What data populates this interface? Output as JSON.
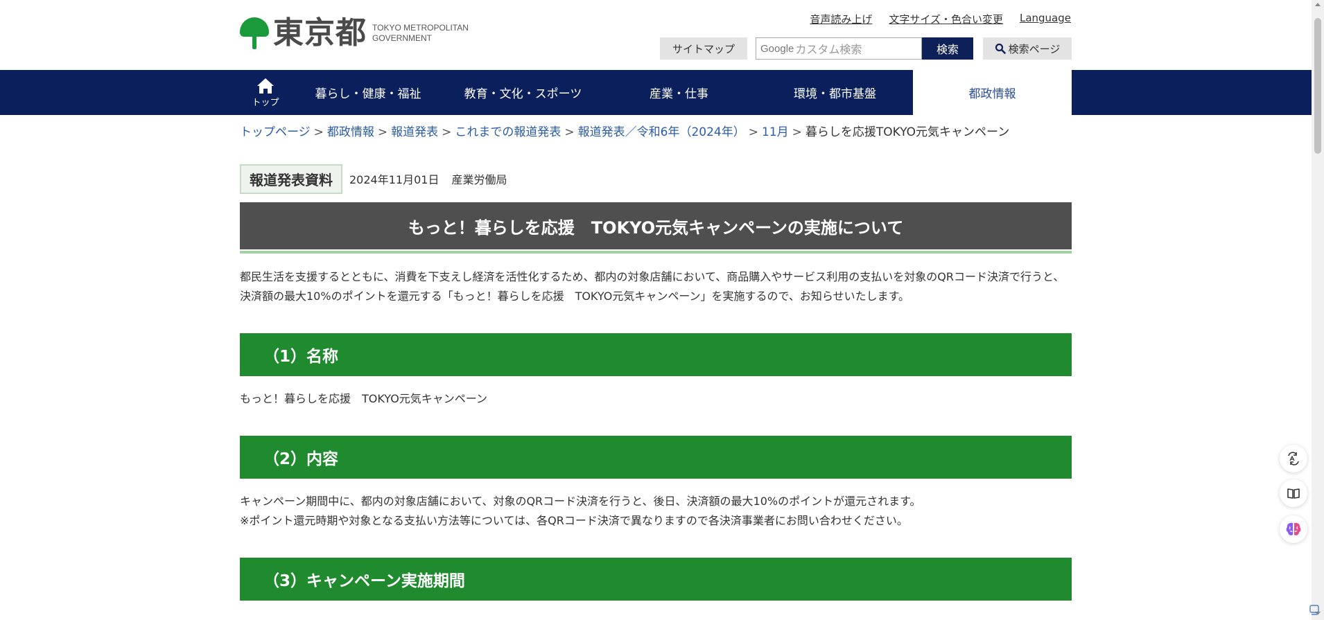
{
  "header": {
    "logo_kanji": "東京都",
    "logo_en_line1": "TOKYO METROPOLITAN",
    "logo_en_line2": "GOVERNMENT",
    "util_links": [
      "音声読み上げ",
      "文字サイズ・色合い変更",
      "Language"
    ],
    "sitemap_label": "サイトマップ",
    "search_placeholder_brand": "Google",
    "search_placeholder": "カスタム検索",
    "search_button": "検索",
    "search_page_label": "検索ページ"
  },
  "nav": {
    "home_label": "トップ",
    "items": [
      "暮らし・健康・福祉",
      "教育・文化・スポーツ",
      "産業・仕事",
      "環境・都市基盤",
      "都政情報"
    ],
    "active_index": 4
  },
  "breadcrumb": {
    "links": [
      "トップページ",
      "都政情報",
      "報道発表",
      "これまでの報道発表",
      "報道発表／令和6年（2024年）",
      "11月"
    ],
    "current": "暮らしを応援TOKYO元気キャンペーン",
    "separator": ">"
  },
  "press": {
    "badge": "報道発表資料",
    "date": "2024年11月01日",
    "department": "産業労働局"
  },
  "title": "もっと！暮らしを応援　TOKYO元気キャンペーンの実施について",
  "intro": "都民生活を支援するとともに、消費を下支えし経済を活性化するため、都内の対象店舗において、商品購入やサービス利用の支払いを対象のQRコード決済で行うと、決済額の最大10%のポイントを還元する「もっと！暮らしを応援　TOKYO元気キャンペーン」を実施するので、お知らせいたします。",
  "sections": [
    {
      "heading": "（1）名称",
      "lines": [
        "もっと！暮らしを応援　TOKYO元気キャンペーン"
      ]
    },
    {
      "heading": "（2）内容",
      "lines": [
        "キャンペーン期間中に、都内の対象店舗において、対象のQRコード決済を行うと、後日、決済額の最大10%のポイントが還元されます。",
        "※ポイント還元時期や対象となる支払い方法等については、各QRコード決済で異なりますので各決済事業者にお問い合わせください。"
      ]
    },
    {
      "heading": "（3）キャンペーン実施期間",
      "lines": []
    }
  ],
  "colors": {
    "nav_bg": "#0b1f5c",
    "section_green": "#1f8a2e",
    "title_gray": "#4f4f4f",
    "link_blue": "#2a5ca8",
    "logo_green": "#1a9a3a"
  },
  "icons": [
    "home-icon",
    "search-icon",
    "translate-icon",
    "reader-icon",
    "ai-brain-icon"
  ]
}
